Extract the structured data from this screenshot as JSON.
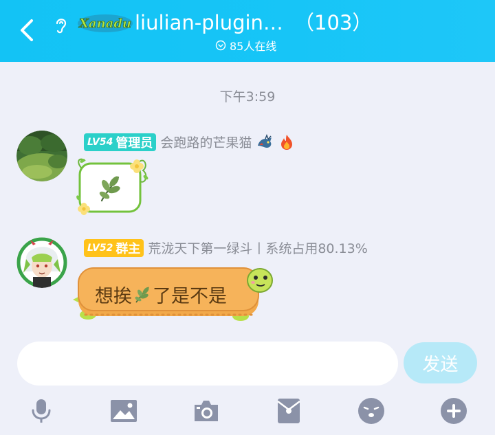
{
  "header": {
    "title": "liulian-plugin…",
    "member_count": "（103）",
    "online": "85人在线",
    "logo_text": "Xanadu"
  },
  "chat": {
    "timestamp": "下午3:59",
    "messages": [
      {
        "level": "LV54",
        "role": "管理员",
        "nickname": "会跑路的芒果猫",
        "tags": [
          "dragon-icon",
          "fire-icon"
        ],
        "content_type": "sticker",
        "sticker": "leaf-sticker"
      },
      {
        "level": "LV52",
        "role": "群主",
        "nickname": "荒泷天下第一绿斗丨系统占用80.13%",
        "content_type": "text",
        "text_before": "想挨",
        "text_after": "了是不是"
      }
    ]
  },
  "composer": {
    "input_value": "",
    "send_label": "发送"
  },
  "toolbar": {
    "items": [
      "microphone-icon",
      "image-icon",
      "camera-icon",
      "red-packet-icon",
      "emoji-icon",
      "plus-icon"
    ]
  },
  "colors": {
    "header": "#17c5f7",
    "admin_badge": "#2bd0c9",
    "owner_badge": "#ffc21a",
    "send_button": "#b6e9f8",
    "toolbar_icon": "#8b92a8"
  }
}
